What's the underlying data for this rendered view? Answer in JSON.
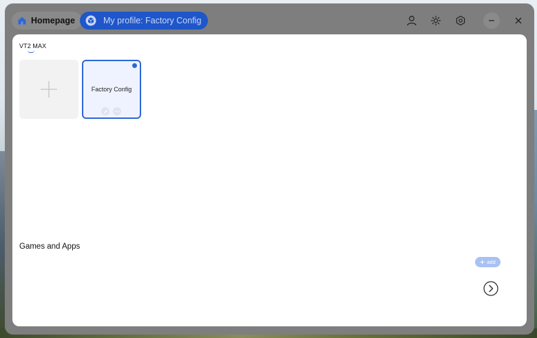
{
  "titlebar": {
    "home_tab": {
      "label": "Homepage",
      "icon": "home-icon"
    },
    "profile_tab": {
      "label": "My profile: Factory Config",
      "icon": "cube-icon"
    },
    "actions": [
      {
        "name": "account-icon"
      },
      {
        "name": "brightness-icon"
      },
      {
        "name": "settings-icon"
      },
      {
        "name": "minimize-icon"
      },
      {
        "name": "close-icon"
      }
    ]
  },
  "device": {
    "name": "VT2 MAX"
  },
  "profiles": {
    "add_card_icon": "plus-icon",
    "items": [
      {
        "name": "Factory Config",
        "active": true
      }
    ]
  },
  "games_apps": {
    "title": "Games and Apps",
    "add_label": "add"
  },
  "colors": {
    "accent": "#2d66d8",
    "tab_active_bg": "#1f56c9",
    "window_frame": "#7e7e7e",
    "add_button_bg": "#a9c1f2"
  }
}
